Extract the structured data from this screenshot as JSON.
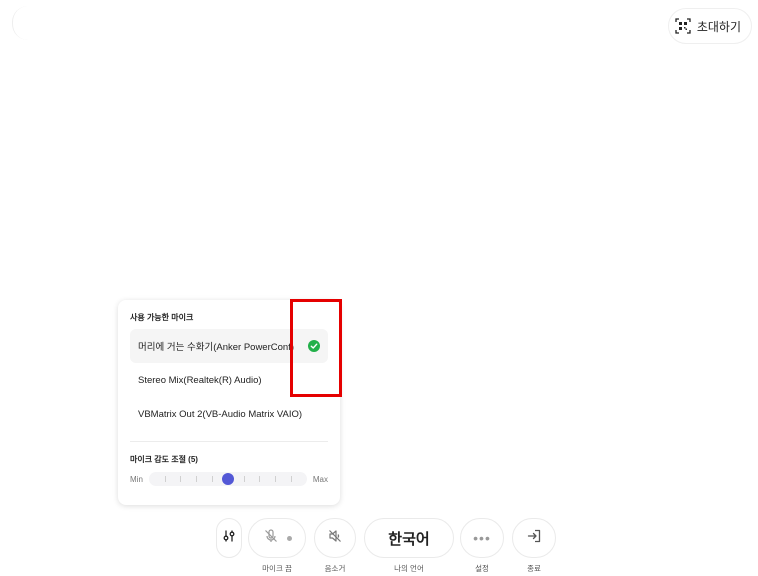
{
  "header": {
    "invite_label": "초대하기"
  },
  "mic_panel": {
    "heading": "사용 가능한 마이크",
    "devices": [
      {
        "label": "머리에 거는 수화기(Anker PowerConf)",
        "selected": true
      },
      {
        "label": "Stereo Mix(Realtek(R) Audio)",
        "selected": false
      },
      {
        "label": "VBMatrix Out 2(VB-Audio Matrix VAIO)",
        "selected": false
      }
    ],
    "sensitivity": {
      "label": "마이크 감도 조절 (5)",
      "value": 5,
      "min": 0,
      "max": 10,
      "min_label": "Min",
      "max_label": "Max"
    },
    "check_color": "#22b04a",
    "thumb_color": "#5358d6"
  },
  "highlight_color": "#e50000",
  "toolbar": {
    "mic_off_label": "마이크 끔",
    "mute_label": "음소거",
    "language_value": "한국어",
    "language_label": "나의 언어",
    "settings_label": "설정",
    "exit_label": "종료"
  }
}
